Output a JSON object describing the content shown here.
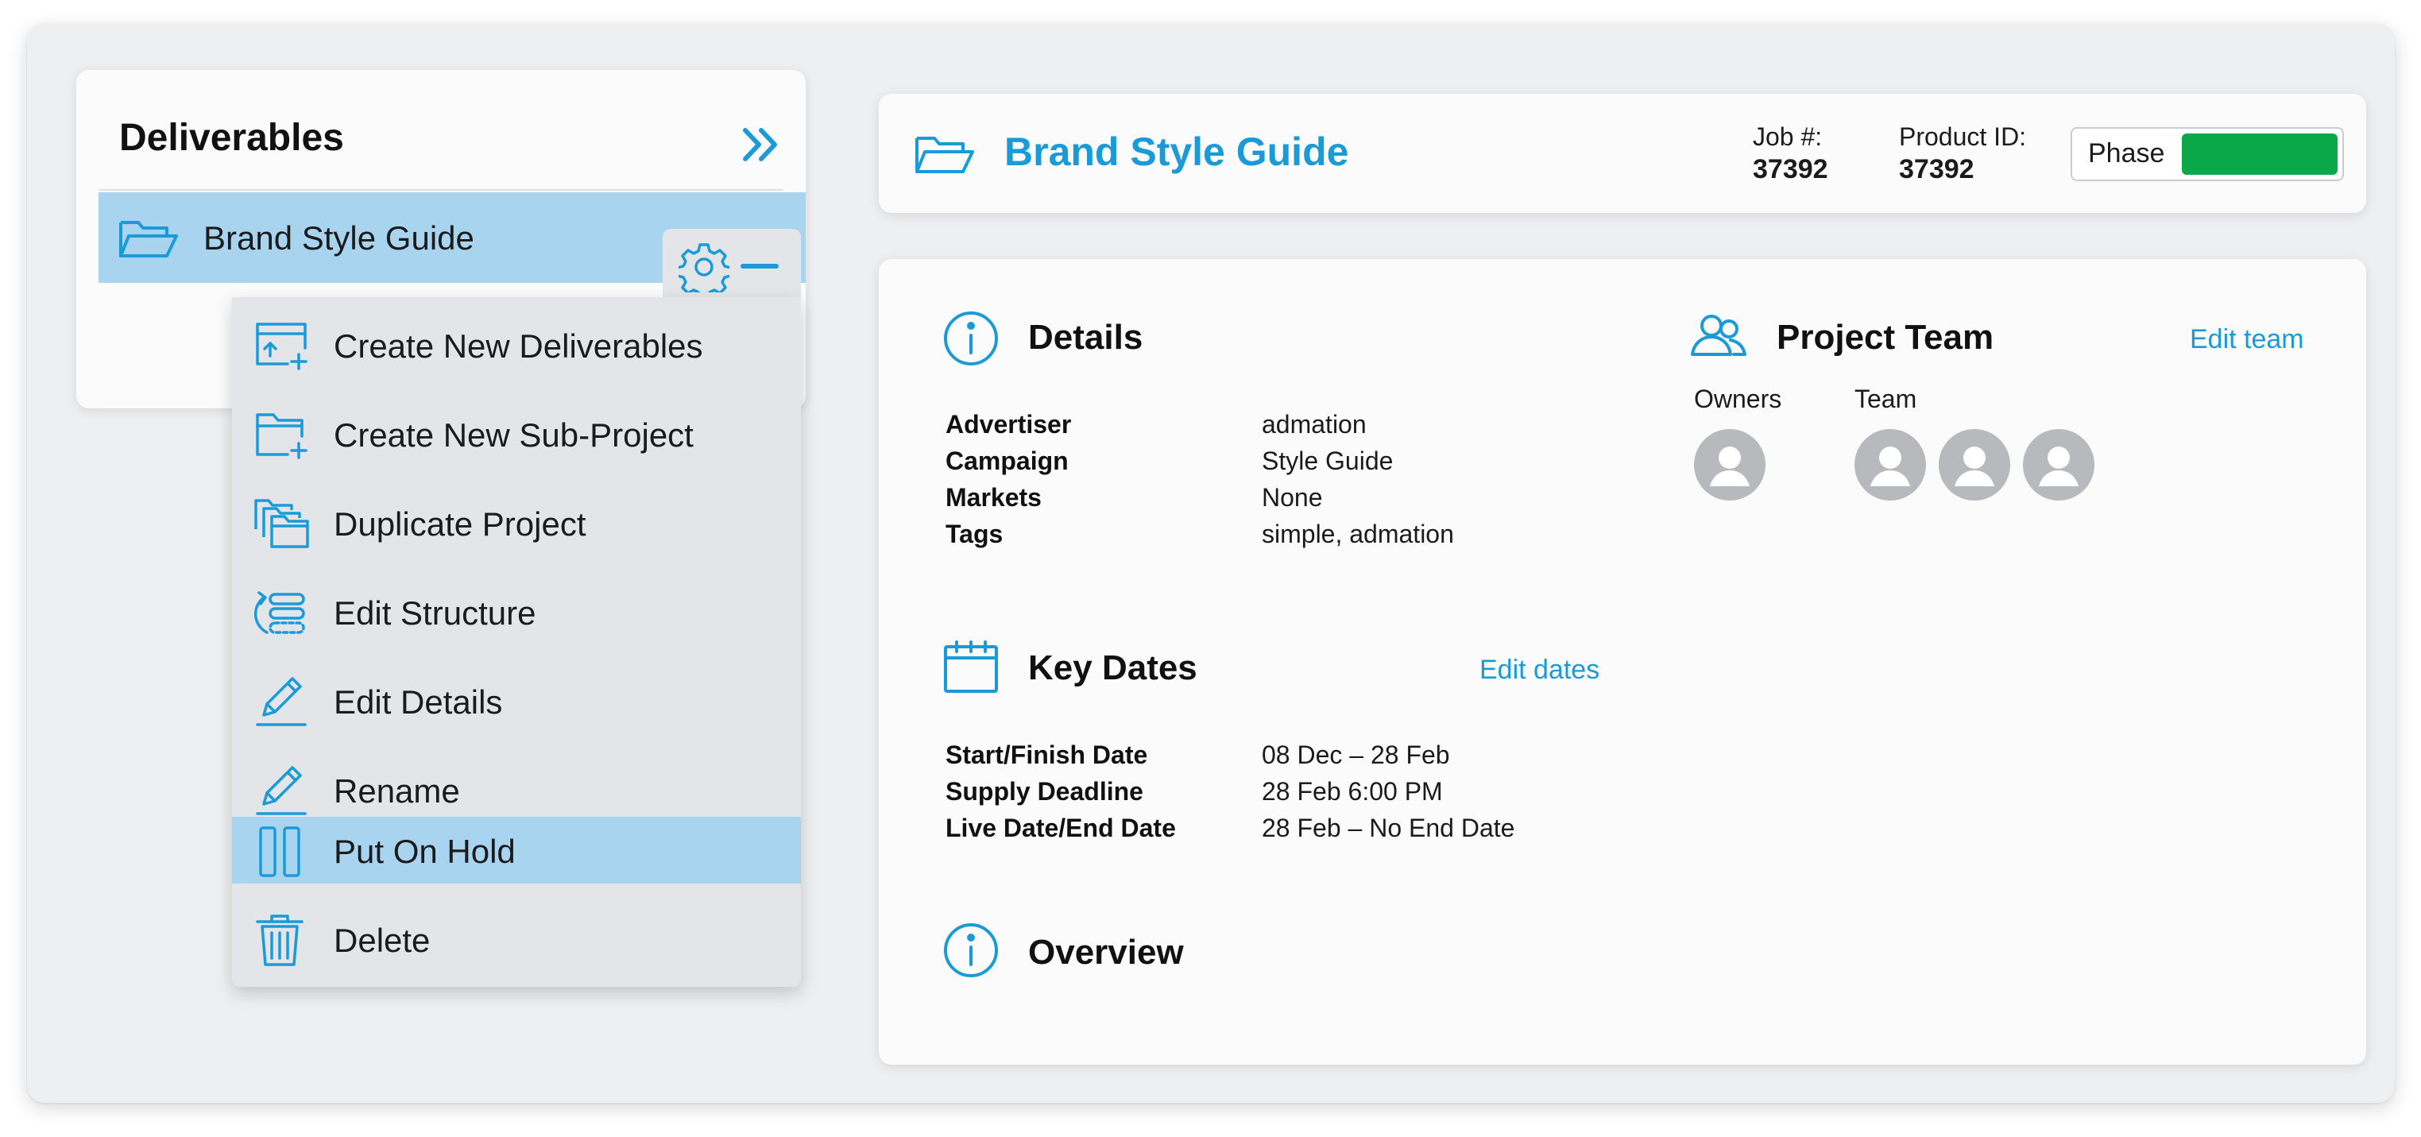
{
  "sidebar": {
    "title": "Deliverables",
    "tree_item": {
      "label": "Brand Style Guide"
    },
    "menu": [
      {
        "label": "Create New Deliverables",
        "icon": "create-deliverable-icon"
      },
      {
        "label": "Create New Sub-Project",
        "icon": "new-subfolder-icon"
      },
      {
        "label": "Duplicate Project",
        "icon": "duplicate-folders-icon"
      },
      {
        "label": "Edit Structure",
        "icon": "edit-structure-icon"
      },
      {
        "label": "Edit Details",
        "icon": "pencil-icon"
      },
      {
        "label": "Rename",
        "icon": "pencil-icon"
      },
      {
        "label": "Put On Hold",
        "icon": "pause-icon",
        "highlighted": true
      },
      {
        "label": "Delete",
        "icon": "trash-icon"
      }
    ]
  },
  "header": {
    "title": "Brand Style Guide",
    "job_label": "Job #:",
    "job_value": "37392",
    "product_label": "Product ID:",
    "product_value": "37392",
    "phase_label": "Phase",
    "phase_color": "#0ba84a"
  },
  "details": {
    "title": "Details",
    "rows": [
      {
        "key": "Advertiser",
        "value": "admation"
      },
      {
        "key": "Campaign",
        "value": "Style Guide"
      },
      {
        "key": "Markets",
        "value": "None"
      },
      {
        "key": "Tags",
        "value": "simple, admation"
      }
    ]
  },
  "team": {
    "title": "Project Team",
    "edit_label": "Edit team",
    "owners_label": "Owners",
    "team_label": "Team"
  },
  "key_dates": {
    "title": "Key Dates",
    "edit_label": "Edit dates",
    "rows": [
      {
        "key": "Start/Finish Date",
        "value": "08 Dec – 28 Feb"
      },
      {
        "key": "Supply Deadline",
        "value": "28 Feb 6:00 PM"
      },
      {
        "key": "Live Date/End Date",
        "value": "28 Feb – No End Date"
      }
    ]
  },
  "overview": {
    "title": "Overview"
  },
  "colors": {
    "accent": "#1a9bd7",
    "highlight": "#a8d4f0",
    "phase": "#0ba84a"
  }
}
